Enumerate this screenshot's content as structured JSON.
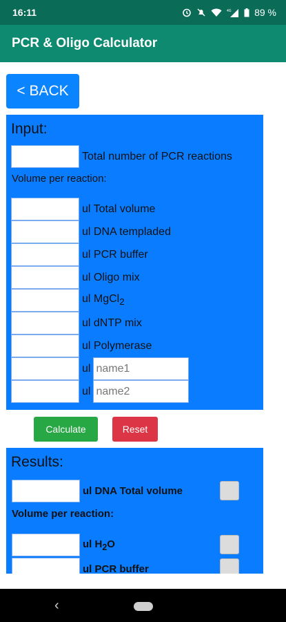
{
  "status_bar": {
    "time": "16:11",
    "battery": "89 %",
    "signal_label": "4G",
    "icons": [
      "alarm-icon",
      "mute-icon",
      "wifi-icon",
      "signal-icon",
      "battery-icon"
    ]
  },
  "app_bar": {
    "title": "PCR & Oligo Calculator"
  },
  "back_button": {
    "label": "< BACK"
  },
  "input": {
    "title": "Input:",
    "total_reactions_label": "Total number of PCR reactions",
    "volume_per_reaction": "Volume per reaction:",
    "rows": [
      {
        "label": "ul Total volume"
      },
      {
        "label": "ul DNA templaded"
      },
      {
        "label": "ul PCR buffer"
      },
      {
        "label": "ul Oligo mix"
      },
      {
        "label": "ul MgCl",
        "sub": "2"
      },
      {
        "label": "ul dNTP mix"
      },
      {
        "label": "ul Polymerase"
      }
    ],
    "custom_rows": [
      {
        "unit": "ul",
        "placeholder": "name1"
      },
      {
        "unit": "ul",
        "placeholder": "name2"
      }
    ]
  },
  "buttons": {
    "calculate": "Calculate",
    "reset": "Reset"
  },
  "results": {
    "title": "Results:",
    "dna_total_label": "ul DNA Total volume",
    "volume_per_reaction": "Volume per reaction:",
    "h2o_label": "ul H",
    "h2o_sub": "2",
    "h2o_suffix": "O",
    "pcr_buffer_label": "ul PCR buffer"
  },
  "colors": {
    "status_bar": "#0a6b57",
    "app_bar": "#0d8a70",
    "panel": "#0a7cff",
    "back_button": "#0a84ff",
    "calculate": "#28a745",
    "reset": "#dc3545"
  }
}
